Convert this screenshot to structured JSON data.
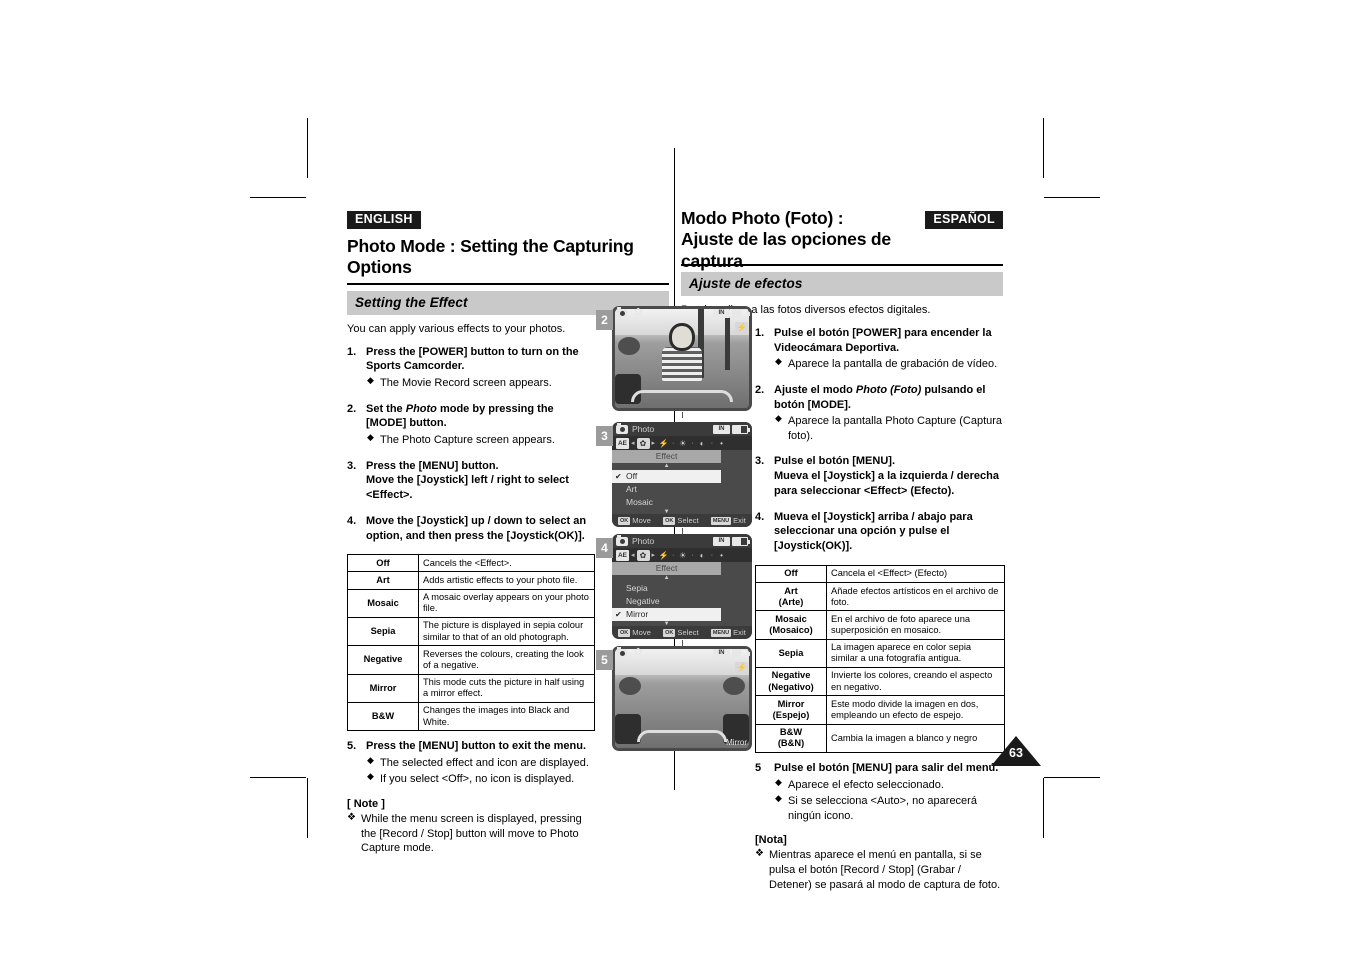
{
  "page": {
    "number": "63"
  },
  "english": {
    "lang_tag": "ENGLISH",
    "title": "Photo Mode : Setting the Capturing Options",
    "section_band": "Setting the Effect",
    "intro": "You can apply various effects to your photos.",
    "steps": [
      {
        "num": "1.",
        "lead": "Press the [POWER] button to turn on the Sports Camcorder.",
        "bullets": [
          "The Movie Record screen appears."
        ]
      },
      {
        "num": "2.",
        "lead_pre": "Set the ",
        "lead_italic": "Photo",
        "lead_post": " mode by pressing the [MODE] button.",
        "bullets": [
          "The Photo Capture screen appears."
        ]
      },
      {
        "num": "3.",
        "lead": "Press the [MENU] button.\nMove the [Joystick] left / right to select <Effect>.",
        "bullets": []
      },
      {
        "num": "4.",
        "lead": "Move the [Joystick] up / down to select an option, and then press the [Joystick(OK)].",
        "bullets": []
      },
      {
        "num": "5.",
        "lead": "Press the [MENU] button to exit the menu.",
        "bullets": [
          "The selected effect and icon are displayed.",
          "If you select <Off>, no icon is displayed."
        ]
      }
    ],
    "table": {
      "rows": [
        {
          "key": "Off",
          "desc": "Cancels the <Effect>."
        },
        {
          "key": "Art",
          "desc": "Adds artistic effects to your photo file."
        },
        {
          "key": "Mosaic",
          "desc": "A mosaic overlay appears on your photo file."
        },
        {
          "key": "Sepia",
          "desc": "The picture is displayed in sepia colour similar to that of an old photograph."
        },
        {
          "key": "Negative",
          "desc": "Reverses the colours, creating the look of a negative."
        },
        {
          "key": "Mirror",
          "desc": "This mode cuts the picture in half using a mirror effect."
        },
        {
          "key": "B&W",
          "desc": "Changes the images into Black and White."
        }
      ]
    },
    "note": {
      "title": "[ Note ]",
      "lines": [
        "While the menu screen is displayed, pressing the [Record / Stop] button will move to Photo Capture mode."
      ]
    }
  },
  "spanish": {
    "lang_tag": "ESPAÑOL",
    "title_line1": "Modo Photo (Foto) :",
    "title_line2": "Ajuste de las opciones de captura",
    "section_band": "Ajuste de efectos",
    "intro": "Puede aplicar a las fotos diversos efectos digitales.",
    "steps": [
      {
        "num": "1.",
        "lead": "Pulse el botón [POWER] para encender la Videocámara Deportiva.",
        "bullets": [
          "Aparece la pantalla de grabación de vídeo."
        ]
      },
      {
        "num": "2.",
        "lead_pre": "Ajuste el modo ",
        "lead_italic": "Photo (Foto)",
        "lead_post": " pulsando el botón [MODE].",
        "bullets": [
          "Aparece la pantalla Photo Capture (Captura foto)."
        ]
      },
      {
        "num": "3.",
        "lead": "Pulse el botón [MENU].\nMueva el [Joystick] a la izquierda / derecha para seleccionar <Effect> (Efecto).",
        "bullets": []
      },
      {
        "num": "4.",
        "lead": "Mueva el [Joystick] arriba / abajo para seleccionar una opción y pulse el [Joystick(OK)].",
        "bullets": []
      },
      {
        "num": "5",
        "lead": "Pulse el botón [MENU] para salir del menú.",
        "bullets": [
          "Aparece el efecto seleccionado.",
          "Si se selecciona <Auto>, no aparecerá ningún icono."
        ]
      }
    ],
    "table": {
      "rows": [
        {
          "key": "Off",
          "desc": "Cancela el <Effect> (Efecto)"
        },
        {
          "key": "Art (Arte)",
          "desc": "Añade efectos artísticos en el archivo de foto."
        },
        {
          "key": "Mosaic (Mosaico)",
          "desc": "En el archivo de foto aparece una superposición en mosaico."
        },
        {
          "key": "Sepia",
          "desc": "La imagen aparece en color sepia similar a una fotografía antigua."
        },
        {
          "key": "Negative (Negativo)",
          "desc": "Invierte los colores, creando el aspecto en negativo."
        },
        {
          "key": "Mirror (Espejo)",
          "desc": "Este modo divide la imagen en dos, empleando un efecto de espejo."
        },
        {
          "key": "B&W (B&N)",
          "desc": "Cambia la imagen a blanco y negro"
        }
      ]
    },
    "note": {
      "title": "[Nota]",
      "lines": [
        "Mientras aparece el menú en pantalla, si se pulsa el botón [Record / Stop] (Grabar / Detener) se pasará al modo de captura de foto."
      ]
    }
  },
  "screens": [
    {
      "badge": "2",
      "kind": "photo",
      "osd_title": "",
      "mem": "IN",
      "effect_label": ""
    },
    {
      "badge": "3",
      "kind": "menu",
      "osd_title": "Photo",
      "mem": "IN",
      "menu_header": "Effect",
      "items": [
        {
          "label": "Off",
          "selected": true,
          "checked": true
        },
        {
          "label": "Art",
          "selected": false,
          "checked": false
        },
        {
          "label": "Mosaic",
          "selected": false,
          "checked": false
        }
      ],
      "bottom": [
        {
          "key": "OK",
          "label": "Move"
        },
        {
          "key": "OK",
          "label": "Select"
        },
        {
          "key": "MENU",
          "label": "Exit"
        }
      ]
    },
    {
      "badge": "4",
      "kind": "menu",
      "osd_title": "Photo",
      "mem": "IN",
      "menu_header": "Effect",
      "items": [
        {
          "label": "Sepia",
          "selected": false,
          "checked": false
        },
        {
          "label": "Negative",
          "selected": false,
          "checked": false
        },
        {
          "label": "Mirror",
          "selected": true,
          "checked": true
        }
      ],
      "bottom": [
        {
          "key": "OK",
          "label": "Move"
        },
        {
          "key": "OK",
          "label": "Select"
        },
        {
          "key": "MENU",
          "label": "Exit"
        }
      ]
    },
    {
      "badge": "5",
      "kind": "photo-mirror",
      "osd_title": "",
      "mem": "IN",
      "effect_label": "Mirror"
    }
  ]
}
